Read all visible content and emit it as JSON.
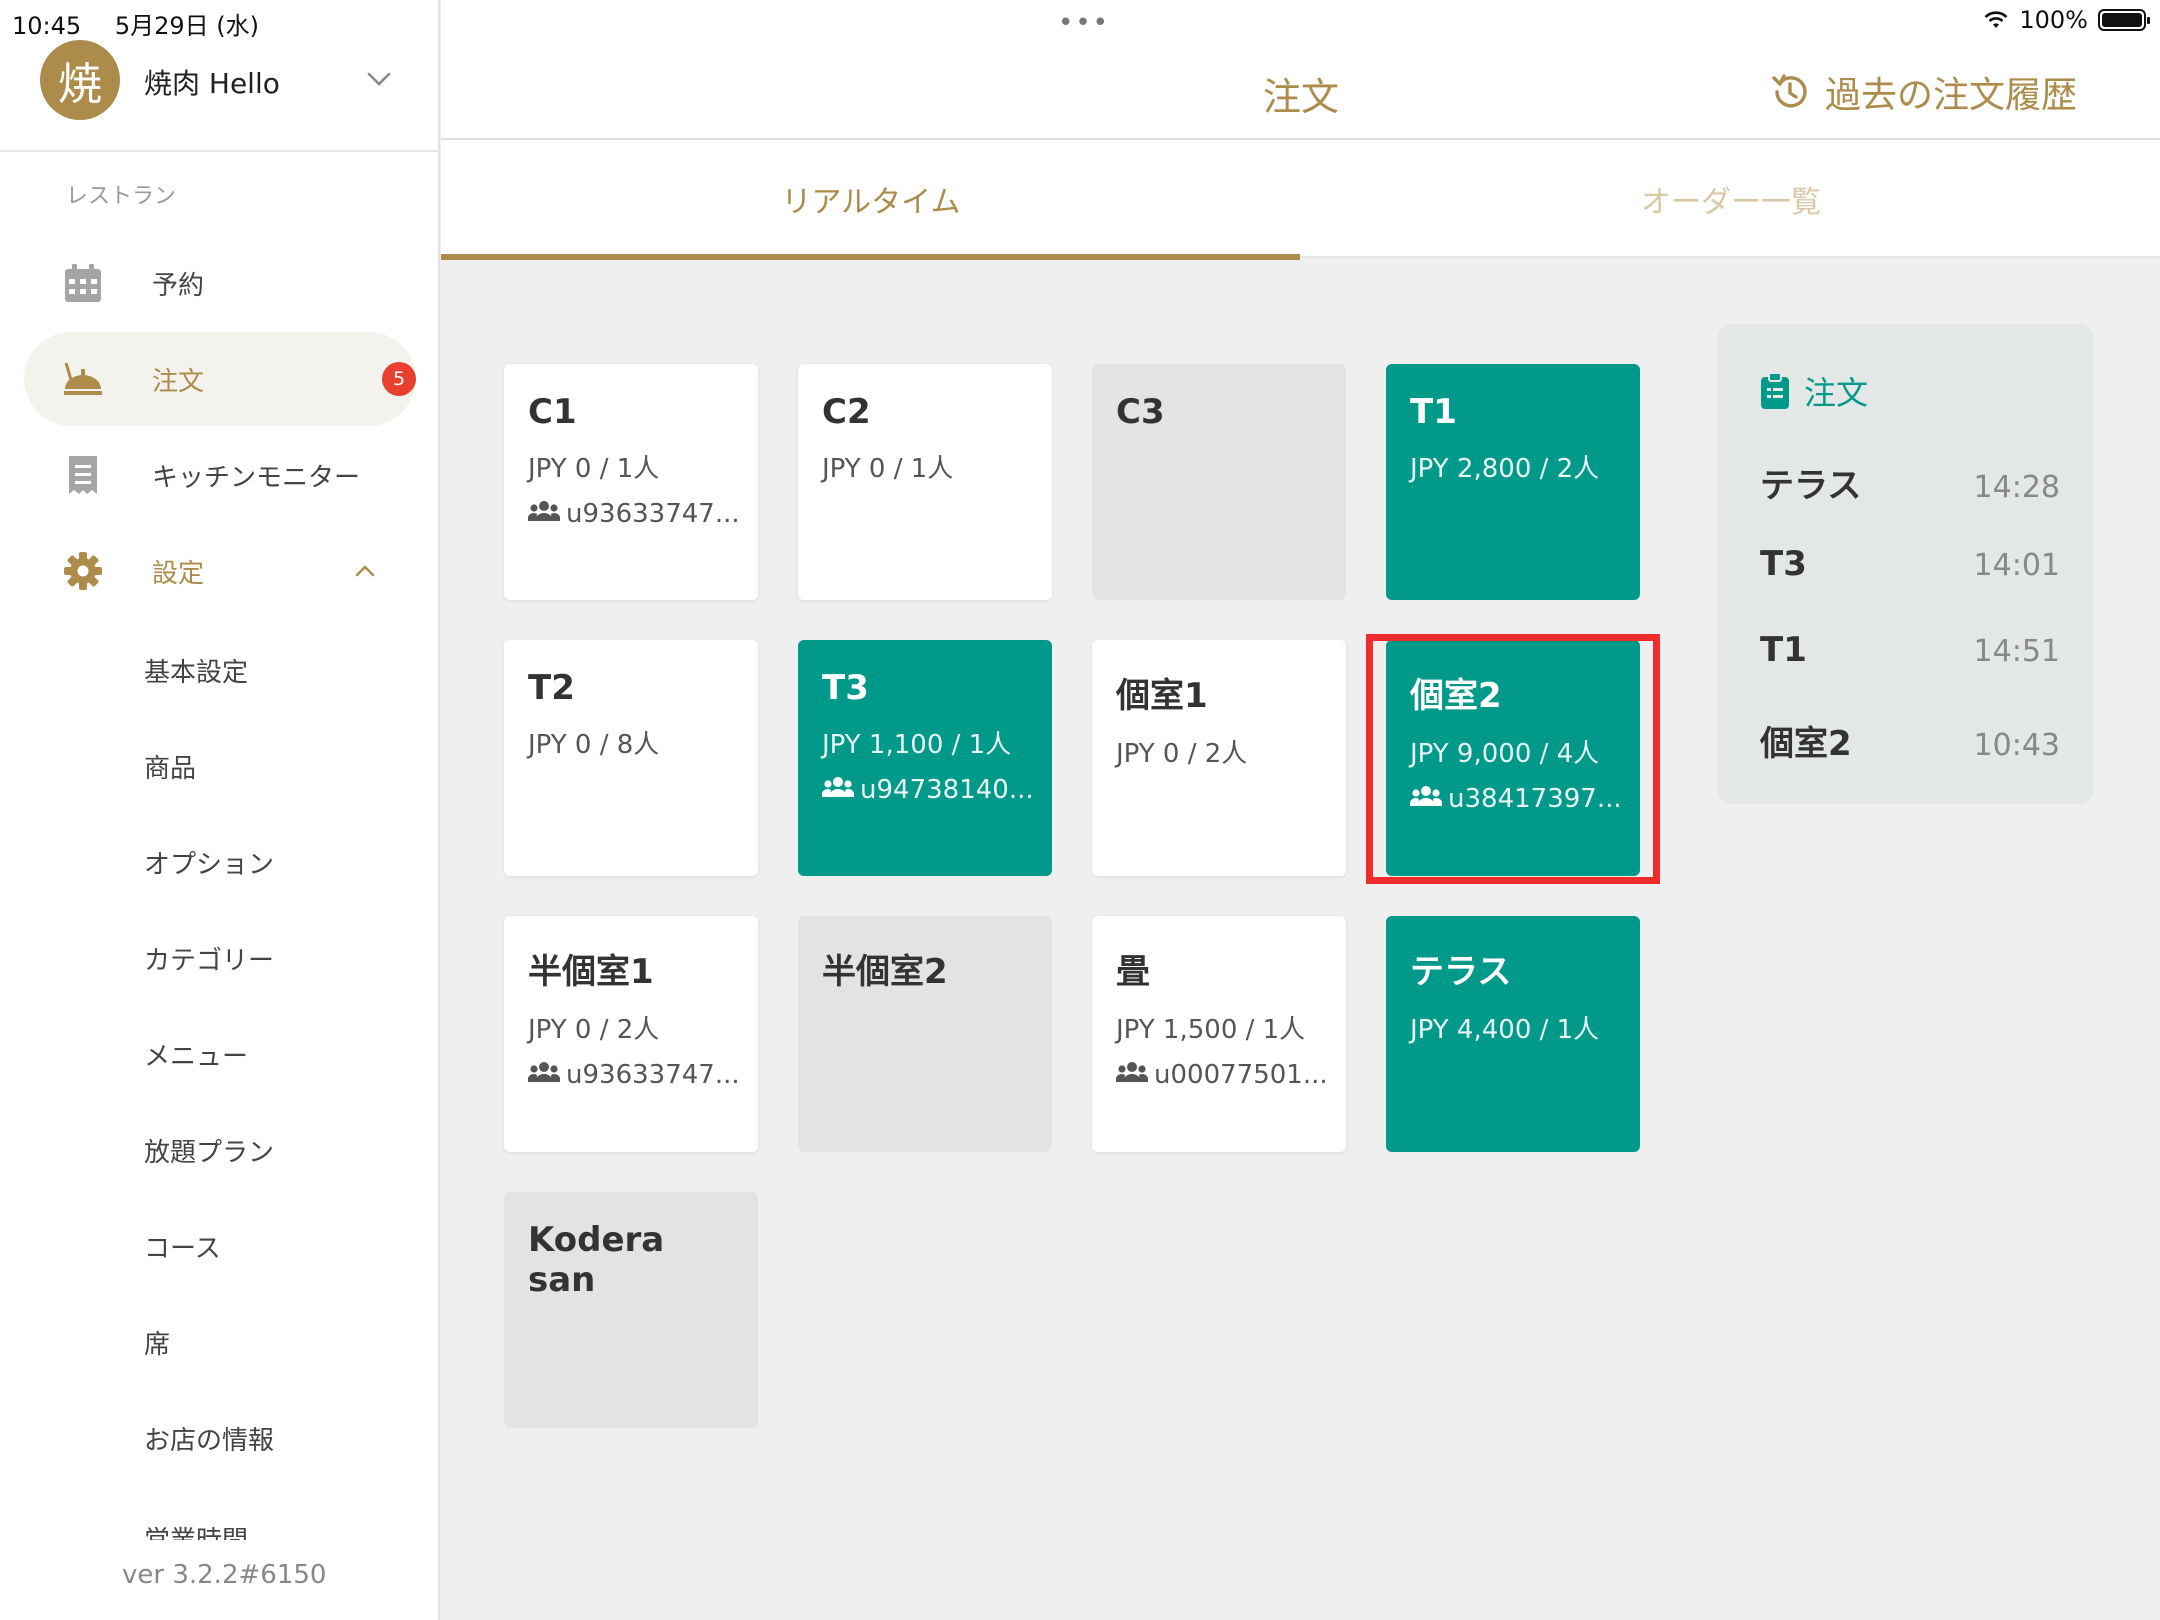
{
  "status_bar": {
    "time": "10:45",
    "date": "5月29日 (水)",
    "dots": "•••",
    "battery_pct": "100%",
    "battery_level": 1.0
  },
  "account": {
    "avatar_char": "焼",
    "name": "焼肉 Hello"
  },
  "sidebar": {
    "section_label": "レストラン",
    "items": [
      {
        "label": "予約"
      },
      {
        "label": "注文",
        "badge": "5"
      },
      {
        "label": "キッチンモニター"
      },
      {
        "label": "設定"
      }
    ],
    "settings_sub": [
      "基本設定",
      "商品",
      "オプション",
      "カテゴリー",
      "メニュー",
      "放題プラン",
      "コース",
      "席",
      "お店の情報",
      "営業時間"
    ],
    "version": "ver 3.2.2#6150"
  },
  "header": {
    "title": "注文",
    "history_label": "過去の注文履歴"
  },
  "tabs": [
    {
      "label": "リアルタイム"
    },
    {
      "label": "オーダー一覧"
    }
  ],
  "tables": [
    {
      "name": "C1",
      "amount": "JPY 0 / 1人",
      "user": "u93633747...",
      "style": "white"
    },
    {
      "name": "C2",
      "amount": "JPY 0 / 1人",
      "user": "",
      "style": "white"
    },
    {
      "name": "C3",
      "amount": "",
      "user": "",
      "style": "gray"
    },
    {
      "name": "T1",
      "amount": "JPY 2,800 / 2人",
      "user": "",
      "style": "teal"
    },
    {
      "name": "T2",
      "amount": "JPY 0 / 8人",
      "user": "",
      "style": "white"
    },
    {
      "name": "T3",
      "amount": "JPY 1,100 / 1人",
      "user": "u94738140...",
      "style": "teal"
    },
    {
      "name": "個室1",
      "amount": "JPY 0 / 2人",
      "user": "",
      "style": "white"
    },
    {
      "name": "個室2",
      "amount": "JPY 9,000 / 4人",
      "user": "u38417397...",
      "style": "teal"
    },
    {
      "name": "半個室1",
      "amount": "JPY 0 / 2人",
      "user": "u93633747...",
      "style": "white"
    },
    {
      "name": "半個室2",
      "amount": "",
      "user": "",
      "style": "gray"
    },
    {
      "name": "畳",
      "amount": "JPY 1,500 / 1人",
      "user": "u00077501...",
      "style": "white"
    },
    {
      "name": "テラス",
      "amount": "JPY 4,400 / 1人",
      "user": "",
      "style": "teal"
    },
    {
      "name": "Kodera san",
      "amount": "",
      "user": "",
      "style": "gray"
    }
  ],
  "orders_panel": {
    "title": "注文",
    "orders": [
      {
        "name": "テラス",
        "time": "14:28"
      },
      {
        "name": "T3",
        "time": "14:01"
      },
      {
        "name": "T1",
        "time": "14:51"
      },
      {
        "name": "個室2",
        "time": "10:43"
      }
    ]
  },
  "colors": {
    "accent_gold": "#ad8c4b",
    "teal": "#01998a",
    "badge_red": "#e8402f",
    "highlight_red": "#ef2b2b",
    "card_gray": "#e3e3e3"
  }
}
